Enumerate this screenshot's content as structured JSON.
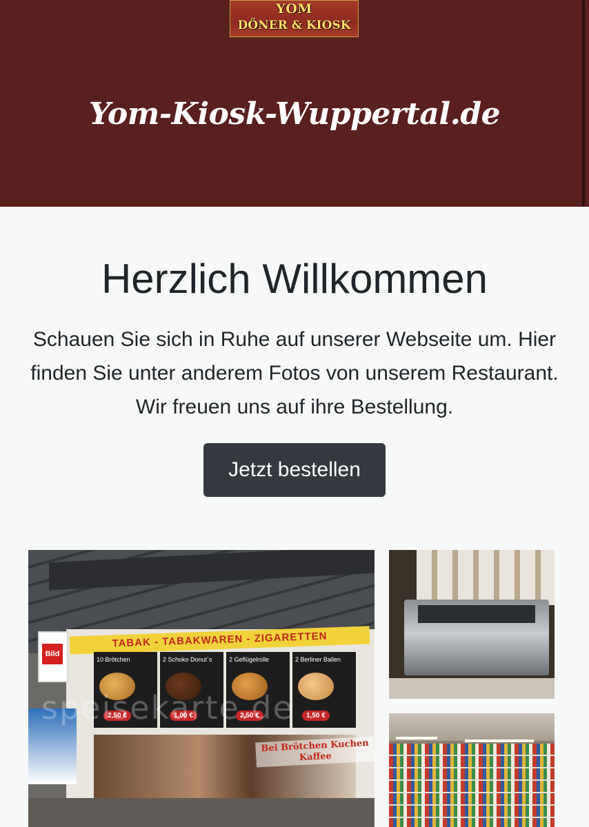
{
  "header": {
    "logo": {
      "line1": "YOM",
      "line2": "DÖNER & KIOSK"
    },
    "site_title": "Yom-Kiosk-Wuppertal.de"
  },
  "main": {
    "heading": "Herzlich Willkommen",
    "intro": "Schauen Sie sich in Ruhe auf unserer Webseite um. Hier finden Sie unter anderem Fotos von unserem Restaurant. Wir freuen uns auf ihre Bestellung.",
    "order_button": "Jetzt bestellen"
  },
  "gallery": {
    "shop_sign": "TABAK - TABAKWAREN - ZIGARETTEN",
    "bild_logo": "Bild",
    "window_panels": [
      {
        "name": "10 Brötchen",
        "price": "2,50 €"
      },
      {
        "name": "2 Schoko Donut`s",
        "price": "1,00 €"
      },
      {
        "name": "2 Geflügelrolle",
        "price": "2,50 €"
      },
      {
        "name": "2 Berliner Ballen",
        "price": "1,50 €"
      }
    ],
    "window_text": "Bei Brötchen Kuchen Kaffee",
    "watermark": "speisekarte.de"
  },
  "colors": {
    "header_bg": "#5a1f1f",
    "page_bg": "#f7f8f8",
    "button_bg": "#343a40",
    "text": "#212529"
  }
}
